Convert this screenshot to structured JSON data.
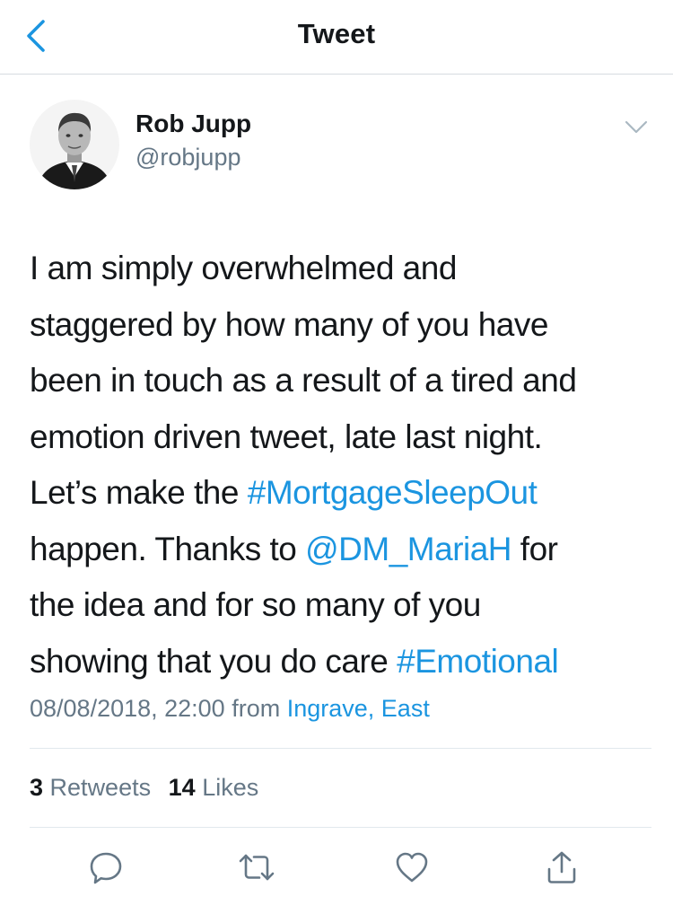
{
  "nav": {
    "title": "Tweet",
    "back_icon": "chevron-left-icon"
  },
  "author": {
    "name": "Rob Jupp",
    "handle": "@robjupp"
  },
  "tweet": {
    "lines": [
      [
        {
          "t": "I am simply overwhelmed and",
          "link": false
        }
      ],
      [
        {
          "t": "staggered by how many of you have",
          "link": false
        }
      ],
      [
        {
          "t": "been in touch as a result of a tired and",
          "link": false
        }
      ],
      [
        {
          "t": "emotion driven tweet, late last night.",
          "link": false
        }
      ],
      [
        {
          "t": "Let’s make the ",
          "link": false
        },
        {
          "t": "#MortgageSleepOut",
          "link": true
        }
      ],
      [
        {
          "t": "happen. Thanks to ",
          "link": false
        },
        {
          "t": "@DM_MariaH",
          "link": true
        },
        {
          "t": " for",
          "link": false
        }
      ],
      [
        {
          "t": "the idea and for so many of you",
          "link": false
        }
      ],
      [
        {
          "t": "showing that you do care ",
          "link": false
        },
        {
          "t": "#Emotional",
          "link": true
        }
      ]
    ]
  },
  "meta": {
    "datetime": "08/08/2018, 22:00",
    "from_label": "from",
    "location": "Ingrave, East"
  },
  "stats": {
    "retweets_count": "3",
    "retweets_label": "Retweets",
    "likes_count": "14",
    "likes_label": "Likes"
  },
  "actions": [
    "reply-icon",
    "retweet-icon",
    "like-icon",
    "share-icon"
  ],
  "colors": {
    "link": "#1b95e0",
    "secondary": "#657786",
    "text": "#14171a",
    "divider": "#e1e8ed"
  }
}
